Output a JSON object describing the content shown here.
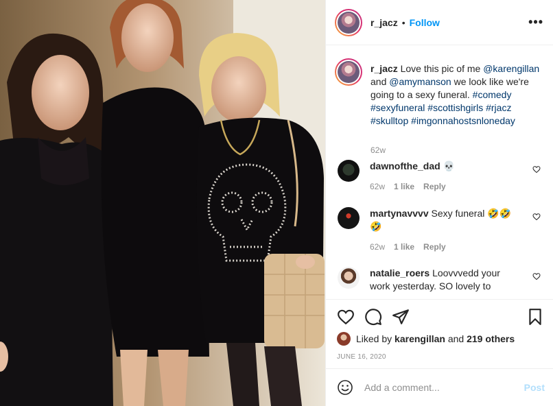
{
  "header": {
    "username": "r_jacz",
    "separator": "•",
    "follow_label": "Follow",
    "more_icon": "more-options-icon"
  },
  "caption": {
    "username": "r_jacz",
    "parts": [
      {
        "t": "Love this pic of me ",
        "link": false
      },
      {
        "t": "@karengillan",
        "link": true
      },
      {
        "t": " and ",
        "link": false
      },
      {
        "t": "@amymanson",
        "link": true
      },
      {
        "t": " we look like we're going to a sexy funeral. ",
        "link": false
      },
      {
        "t": "#comedy",
        "link": true
      },
      {
        "t": " ",
        "link": false
      },
      {
        "t": "#sexyfuneral",
        "link": true
      },
      {
        "t": " ",
        "link": false
      },
      {
        "t": "#scottishgirls",
        "link": true
      },
      {
        "t": " ",
        "link": false
      },
      {
        "t": "#rjacz",
        "link": true
      },
      {
        "t": " ",
        "link": false
      },
      {
        "t": "#skulltop",
        "link": true
      },
      {
        "t": " ",
        "link": false
      },
      {
        "t": "#imgonnahostsnloneday",
        "link": true
      }
    ],
    "time": "62w"
  },
  "comments": [
    {
      "username": "dawnofthe_dad",
      "text": "💀",
      "time": "62w",
      "likes": "1 like",
      "reply": "Reply"
    },
    {
      "username": "martynavvvv",
      "text": "Sexy funeral 🤣🤣🤣",
      "time": "62w",
      "likes": "1 like",
      "reply": "Reply"
    },
    {
      "username": "natalie_roers",
      "text": "Loovvvedd your work yesterday. SO lovely to",
      "time": "",
      "likes": "",
      "reply": ""
    }
  ],
  "actions": {
    "likes_prefix": "Liked by",
    "likes_user": "karengillan",
    "likes_and": "and",
    "likes_count": "219 others",
    "date": "JUNE 16, 2020"
  },
  "add_comment": {
    "placeholder": "Add a comment...",
    "post_label": "Post"
  },
  "colors": {
    "accent": "#0095f6",
    "link": "#00376b",
    "muted": "#8e8e8e",
    "post_disabled": "#b2dffc"
  }
}
